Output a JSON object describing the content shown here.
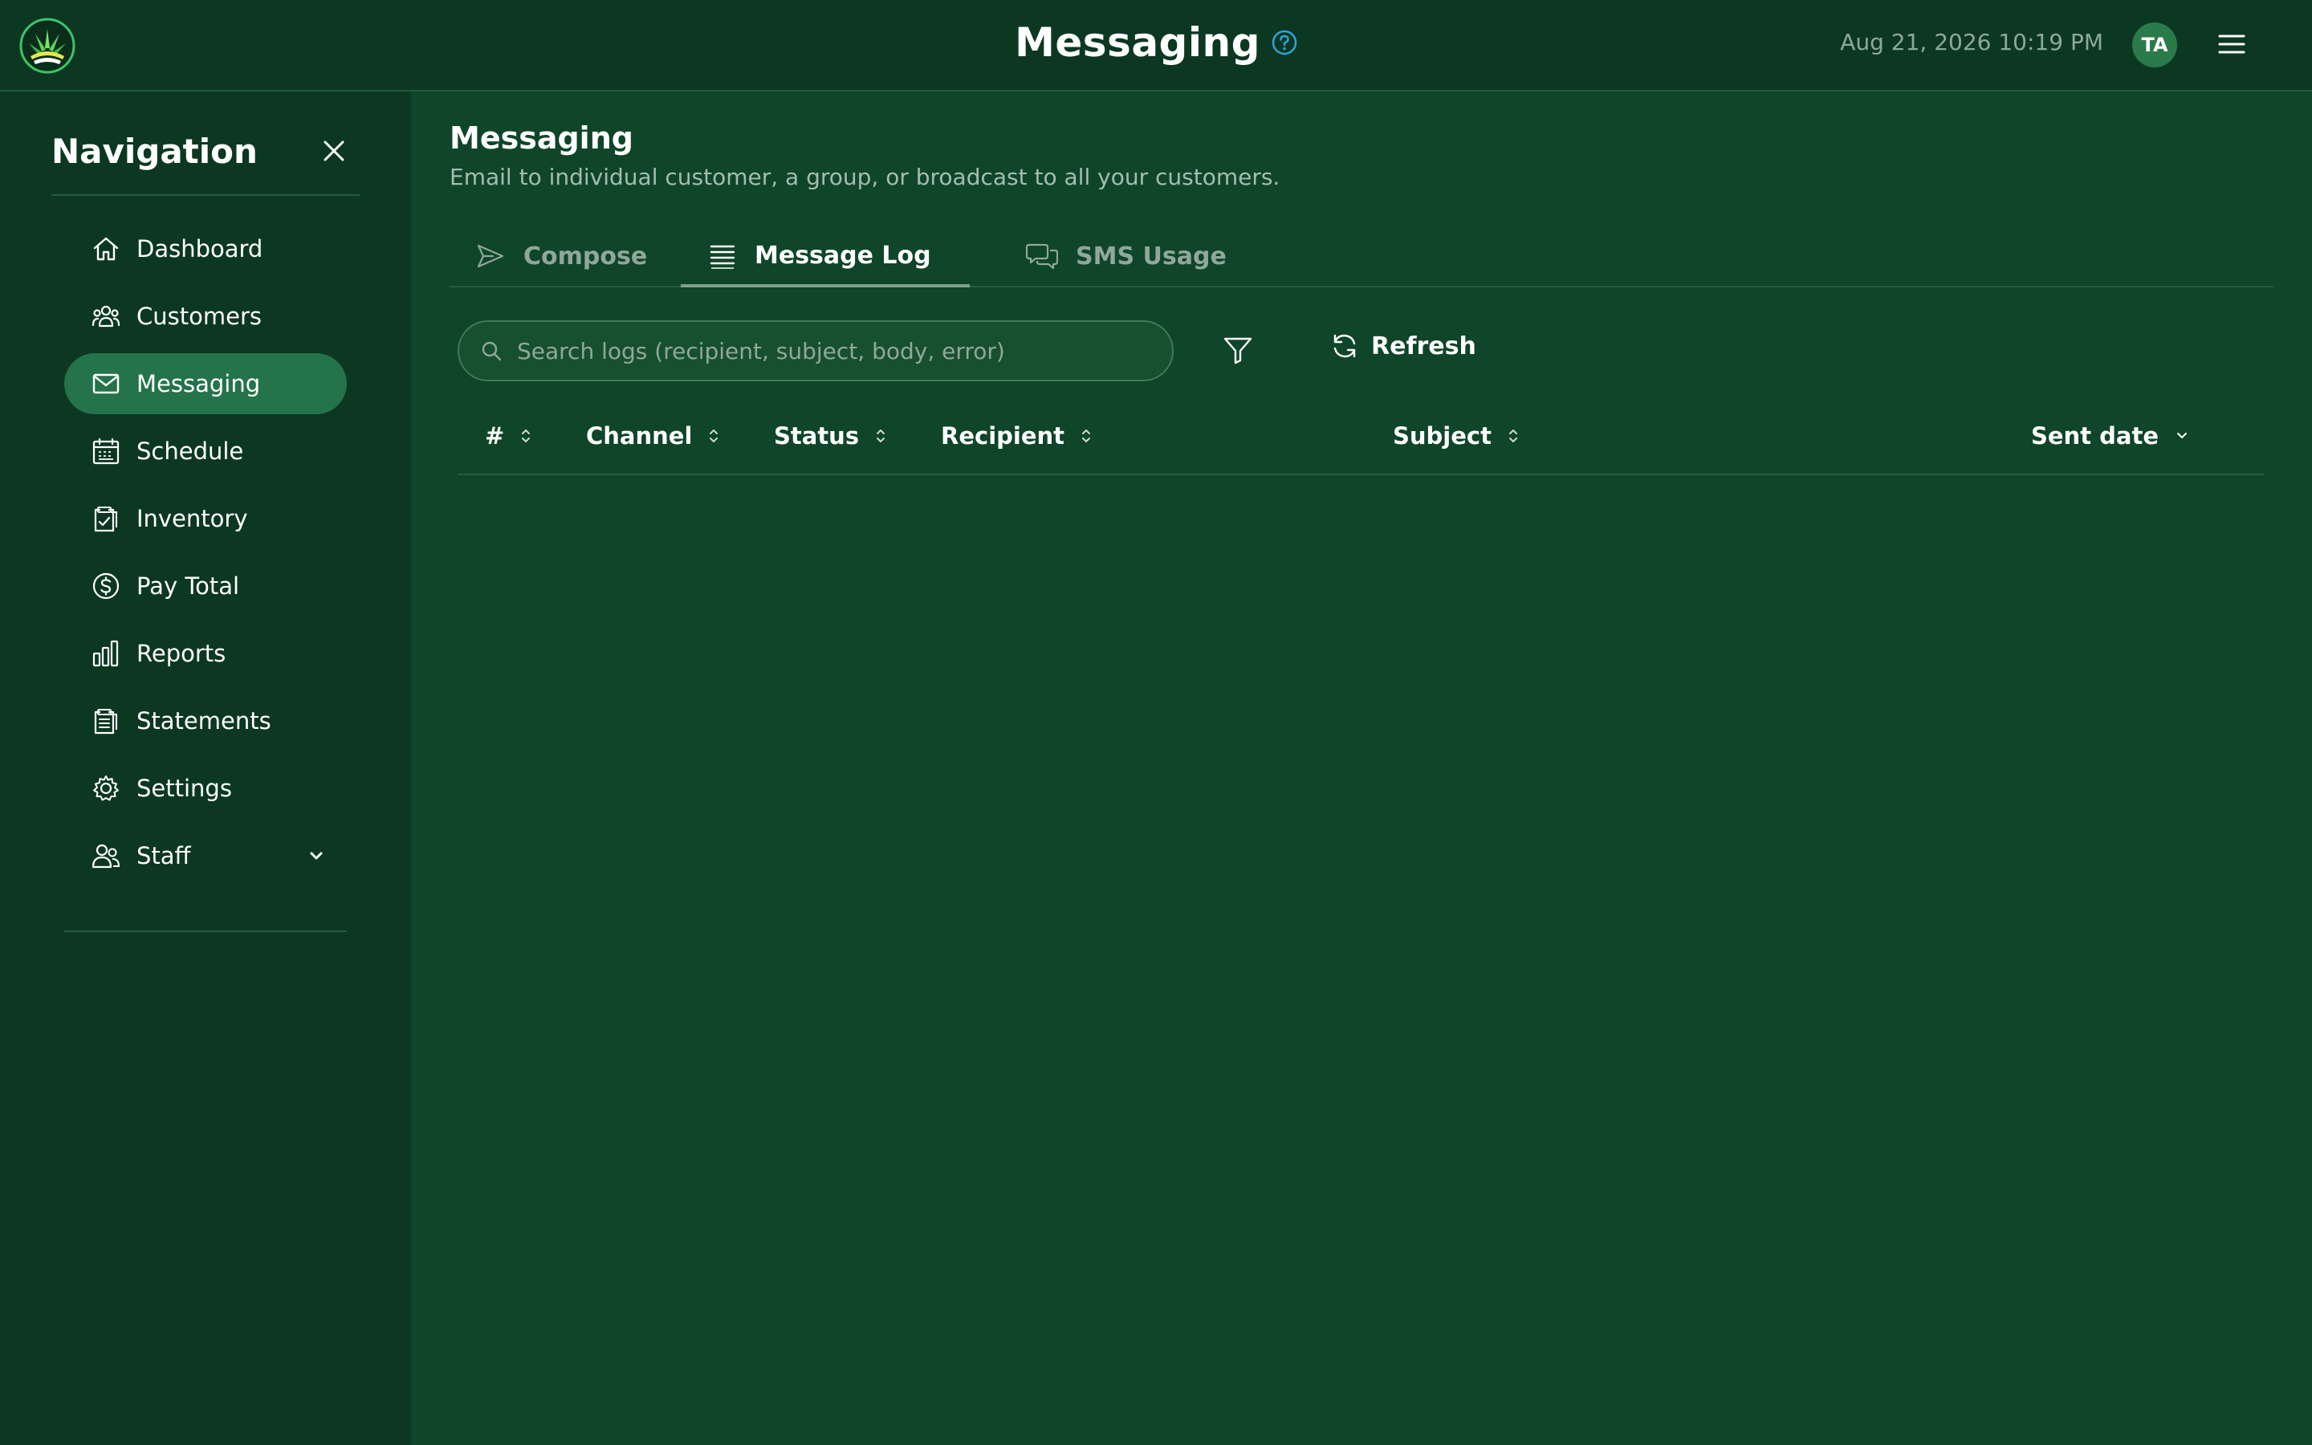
{
  "header": {
    "title": "Messaging",
    "datetime": "Aug 21, 2026 10:19 PM",
    "avatar_initials": "TA"
  },
  "sidebar": {
    "title": "Navigation",
    "items": [
      {
        "label": "Dashboard",
        "icon": "home-icon"
      },
      {
        "label": "Customers",
        "icon": "users-icon"
      },
      {
        "label": "Messaging",
        "icon": "mail-icon",
        "active": true
      },
      {
        "label": "Schedule",
        "icon": "calendar-icon"
      },
      {
        "label": "Inventory",
        "icon": "clipboard-check-icon"
      },
      {
        "label": "Pay Total",
        "icon": "dollar-icon"
      },
      {
        "label": "Reports",
        "icon": "bar-chart-icon"
      },
      {
        "label": "Statements",
        "icon": "clipboard-list-icon"
      },
      {
        "label": "Settings",
        "icon": "gear-icon"
      },
      {
        "label": "Staff",
        "icon": "staff-icon",
        "expandable": true
      }
    ]
  },
  "main": {
    "title": "Messaging",
    "subtitle": "Email to individual customer, a group, or broadcast to all your customers.",
    "tabs": [
      {
        "label": "Compose",
        "icon": "send-icon"
      },
      {
        "label": "Message Log",
        "icon": "list-icon",
        "active": true
      },
      {
        "label": "SMS Usage",
        "icon": "chat-icon"
      }
    ],
    "search": {
      "placeholder": "Search logs (recipient, subject, body, error)",
      "value": ""
    },
    "refresh_label": "Refresh",
    "table": {
      "columns": [
        "#",
        "Channel",
        "Status",
        "Recipient",
        "Subject",
        "Sent date"
      ],
      "sorted_column": "Sent date",
      "rows": []
    }
  },
  "colors": {
    "background": "#0f4528",
    "sidebar": "#0c3822",
    "active_item": "#24734a",
    "help_icon": "#2ea3d8"
  }
}
